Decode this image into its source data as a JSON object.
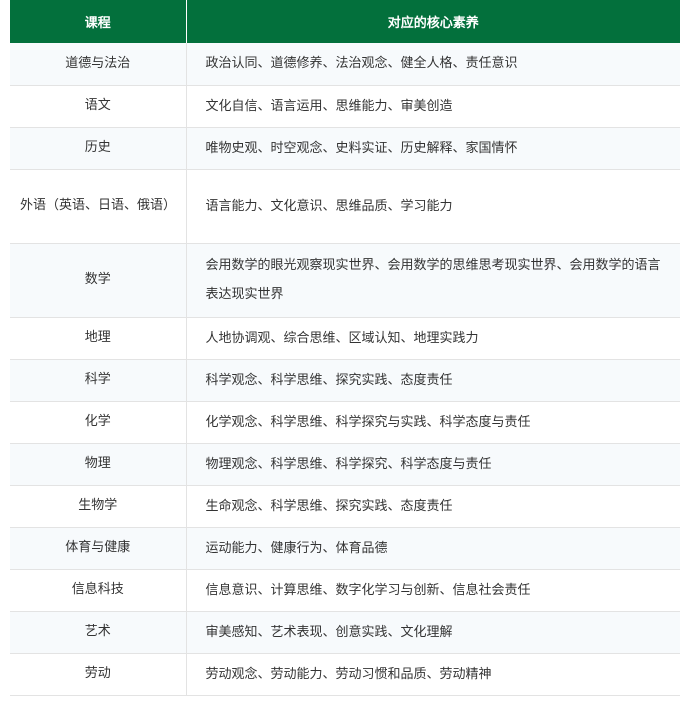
{
  "header": {
    "course": "课程",
    "quality": "对应的核心素养"
  },
  "rows": [
    {
      "course": "道德与法治",
      "quality": "政治认同、道德修养、法治观念、健全人格、责任意识"
    },
    {
      "course": "语文",
      "quality": "文化自信、语言运用、思维能力、审美创造"
    },
    {
      "course": "历史",
      "quality": "唯物史观、时空观念、史料实证、历史解释、家国情怀"
    },
    {
      "course": "外语（英语、日语、俄语）",
      "quality": "语言能力、文化意识、思维品质、学习能力"
    },
    {
      "course": "数学",
      "quality": "会用数学的眼光观察现实世界、会用数学的思维思考现实世界、会用数学的语言表达现实世界"
    },
    {
      "course": "地理",
      "quality": "人地协调观、综合思维、区域认知、地理实践力"
    },
    {
      "course": "科学",
      "quality": "科学观念、科学思维、探究实践、态度责任"
    },
    {
      "course": "化学",
      "quality": "化学观念、科学思维、科学探究与实践、科学态度与责任"
    },
    {
      "course": "物理",
      "quality": "物理观念、科学思维、科学探究、科学态度与责任"
    },
    {
      "course": "生物学",
      "quality": "生命观念、科学思维、探究实践、态度责任"
    },
    {
      "course": "体育与健康",
      "quality": "运动能力、健康行为、体育品德"
    },
    {
      "course": "信息科技",
      "quality": "信息意识、计算思维、数字化学习与创新、信息社会责任"
    },
    {
      "course": "艺术",
      "quality": "审美感知、艺术表现、创意实践、文化理解"
    },
    {
      "course": "劳动",
      "quality": "劳动观念、劳动能力、劳动习惯和品质、劳动精神"
    }
  ]
}
